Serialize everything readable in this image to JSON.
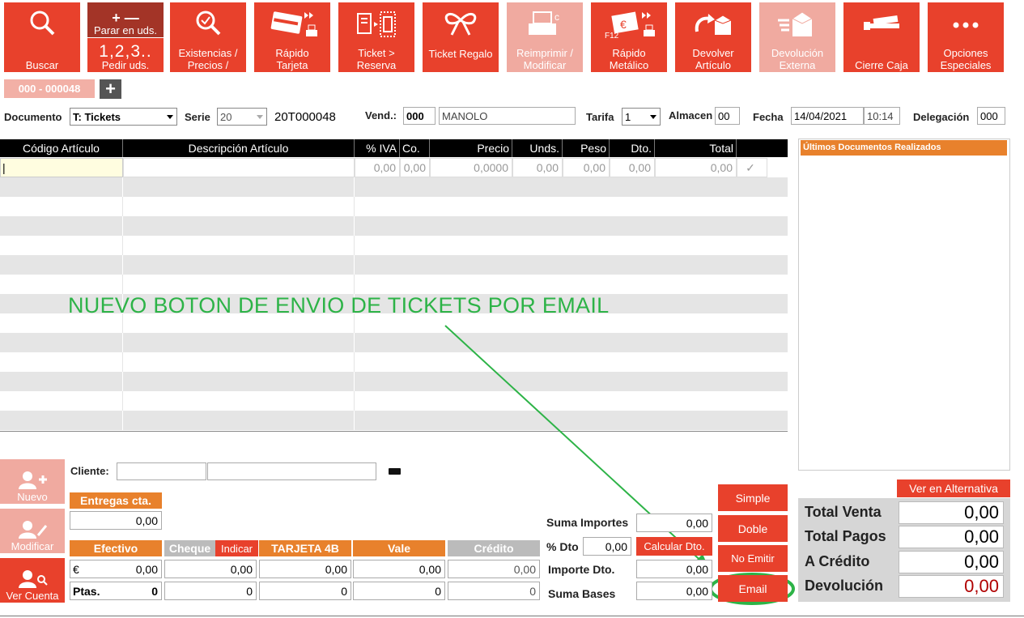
{
  "toolbar": {
    "buscar": "Buscar",
    "parar": "Parar en uds.",
    "pedir_big": "1,2,3..",
    "pedir": "Pedir uds.",
    "existencias": "Existencias /\nPrecios /",
    "rapido_tarjeta": "Rápido\nTarjeta",
    "ticket_reserva": "Ticket >\nReserva",
    "ticket_regalo": "Ticket Regalo",
    "reimprimir": "Reimprimir /\nModificar",
    "rapido_metalico": "Rápido\nMetálico",
    "devolver": "Devolver\nArtículo",
    "devolucion_ext": "Devolución\nExterna",
    "cierre": "Cierre Caja",
    "opciones": "Opciones\nEspeciales",
    "f12": "F12"
  },
  "doc_tab": "000 - 000048",
  "header": {
    "documento_label": "Documento",
    "documento_value": "T: Tickets",
    "serie_label": "Serie",
    "serie_value": "20",
    "doc_number": "20T000048",
    "vend_label": "Vend.:",
    "vend_code": "000",
    "vend_name": "MANOLO",
    "tarifa_label": "Tarifa",
    "tarifa_value": "1",
    "almacen_label": "Almacen",
    "almacen_value": "00",
    "fecha_label": "Fecha",
    "fecha_value": "14/04/2021",
    "hora_value": "10:14",
    "delegacion_label": "Delegación",
    "delegacion_value": "000"
  },
  "grid": {
    "columns": [
      "Código Artículo",
      "Descripción Artículo",
      "% IVA",
      "Co.",
      "Precio",
      "Unds.",
      "Peso",
      "Dto.",
      "Total"
    ],
    "first_row": [
      "0,00",
      "0,00",
      "0,0000",
      "0,00",
      "0,00",
      "0,00",
      "0,00"
    ]
  },
  "side_panel_title": "Últimos Documentos Realizados",
  "annotation": "NUEVO BOTON DE ENVIO DE TICKETS POR EMAIL",
  "left_buttons": {
    "nuevo": "Nuevo",
    "modificar": "Modificar",
    "ver_cuenta": "Ver Cuenta"
  },
  "cliente_label": "Cliente:",
  "entregas": {
    "label": "Entregas cta.",
    "value": "0,00"
  },
  "payments": {
    "efectivo": "Efectivo",
    "cheque": "Cheque",
    "indicar": "Indicar",
    "tarjeta": "TARJETA 4B",
    "vale": "Vale",
    "credito": "Crédito",
    "euro_label": "€",
    "ptas_label": "Ptas.",
    "euro_values": [
      "0,00",
      "0,00",
      "0,00",
      "0,00",
      "0,00"
    ],
    "ptas_values": [
      "0",
      "0",
      "0",
      "0",
      "0"
    ]
  },
  "summary": {
    "suma_importes_label": "Suma Importes",
    "suma_importes": "0,00",
    "dto_label": "% Dto",
    "dto": "0,00",
    "calcular": "Calcular Dto.",
    "importe_dto_label": "Importe Dto.",
    "importe_dto": "0,00",
    "suma_bases_label": "Suma Bases",
    "suma_bases": "0,00"
  },
  "print_buttons": {
    "simple": "Simple",
    "doble": "Doble",
    "no_emitir": "No Emitir",
    "email": "Email"
  },
  "ver_alternativa": "Ver en Alternativa",
  "totals": {
    "total_venta_label": "Total Venta",
    "total_venta": "0,00",
    "total_pagos_label": "Total Pagos",
    "total_pagos": "0,00",
    "a_credito_label": "A Crédito",
    "a_credito": "0,00",
    "devolucion_label": "Devolución",
    "devolucion": "0,00"
  },
  "colors": {
    "accent": "#e8412c",
    "orange": "#e8812c",
    "annotation": "#2db347",
    "disabled": "#f0aaa0"
  }
}
